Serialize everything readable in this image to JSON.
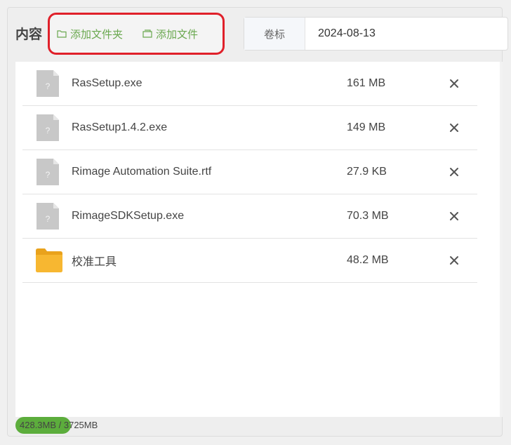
{
  "header": {
    "content_label": "内容",
    "add_folder_label": "添加文件夹",
    "add_file_label": "添加文件"
  },
  "volume_label": {
    "prefix": "卷标",
    "value": "2024-08-13"
  },
  "files": [
    {
      "name": "RasSetup.exe",
      "size": "161 MB",
      "type": "file"
    },
    {
      "name": "RasSetup1.4.2.exe",
      "size": "149 MB",
      "type": "file"
    },
    {
      "name": "Rimage Automation Suite.rtf",
      "size": "27.9 KB",
      "type": "file"
    },
    {
      "name": "RimageSDKSetup.exe",
      "size": "70.3 MB",
      "type": "file"
    },
    {
      "name": "校准工具",
      "size": "48.2 MB",
      "type": "folder"
    }
  ],
  "usage": {
    "text": "428.3MB / 3725MB",
    "fraction": 0.115
  },
  "icons": {
    "folder": "folder-icon",
    "file": "file-unknown-icon",
    "remove": "close-icon",
    "add_folder": "folder-outline-icon",
    "add_file": "file-outline-icon"
  },
  "colors": {
    "accent_green": "#6aa84f",
    "highlight_red": "#e0202a",
    "usage_fill": "#5cad3c",
    "folder_yellow": "#f7b731"
  }
}
